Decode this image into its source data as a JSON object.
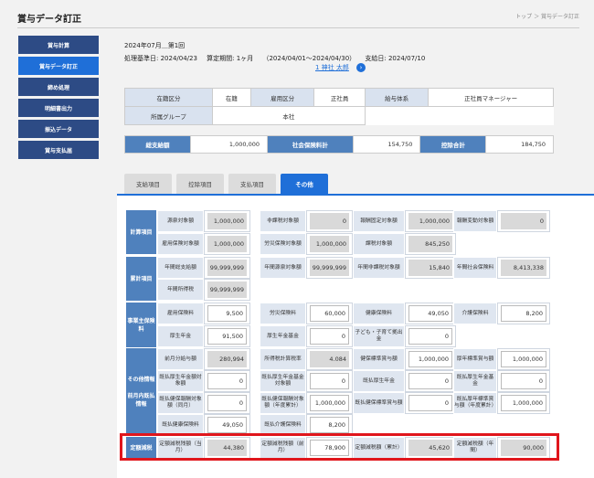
{
  "header": {
    "title": "賞与データ訂正",
    "breadcrumb": "トップ ＞ 賞与データ訂正"
  },
  "sidebar": {
    "items": [
      {
        "label": "賞与計算",
        "active": false
      },
      {
        "label": "賞与データ訂正",
        "active": true
      },
      {
        "label": "締め処理",
        "active": false
      },
      {
        "label": "明細書出力",
        "active": false
      },
      {
        "label": "振込データ",
        "active": false
      },
      {
        "label": "賞与支払届",
        "active": false
      }
    ]
  },
  "info": {
    "period": "2024年07月＿第1回",
    "base_date": "処理基準日: 2024/04/23",
    "calc_period": "算定期間: 1ヶ月",
    "range": "（2024/04/01〜2024/04/30）",
    "pay_date": "支給日: 2024/07/10",
    "employee": "1 神社 太郎"
  },
  "summary": {
    "row1": [
      "在籍区分",
      "在籍",
      "雇用区分",
      "正社員",
      "給与体系",
      "正社員マネージャー"
    ],
    "group_label": "所属グループ",
    "group_value": "本社",
    "totals": [
      "総支給額",
      "1,000,000",
      "社会保険料計",
      "154,750",
      "控除合計",
      "184,750"
    ]
  },
  "tabs": [
    {
      "label": "支給項目",
      "active": false
    },
    {
      "label": "控除項目",
      "active": false
    },
    {
      "label": "支払項目",
      "active": false
    },
    {
      "label": "その他",
      "active": true
    }
  ],
  "sections": {
    "keisan": "計算項目",
    "ruikei": "累計項目",
    "jigyonushi": "事業主保険料",
    "sonota": "その他情報\n\n前月内既払情報",
    "teigaku": "定額減税"
  },
  "cells": {
    "r1": [
      [
        "源泉対象額",
        "1,000,000"
      ],
      [
        "非課税対象額",
        "0"
      ],
      [
        "報酬固定対象額",
        "1,000,000"
      ],
      [
        "報酬変動対象額",
        "0"
      ]
    ],
    "r2": [
      [
        "雇用保険対象額",
        "1,000,000"
      ],
      [
        "労災保険対象額",
        "1,000,000"
      ],
      [
        "課税対象額",
        "845,250"
      ]
    ],
    "r3": [
      [
        "年間総支給額",
        "99,999,999"
      ],
      [
        "年間源泉対象額",
        "99,999,999"
      ],
      [
        "年間非課税対象額",
        "15,840"
      ],
      [
        "年間社会保険料",
        "8,413,338"
      ]
    ],
    "r4": [
      [
        "年間所得税",
        "99,999,999"
      ]
    ],
    "r5": [
      [
        "雇用保険料",
        "9,500"
      ],
      [
        "労災保険料",
        "60,000"
      ],
      [
        "健康保険料",
        "49,050"
      ],
      [
        "介護保険料",
        "8,200"
      ]
    ],
    "r6": [
      [
        "厚生年金",
        "91,500"
      ],
      [
        "厚生年金基金",
        "0"
      ],
      [
        "子ども・子育て拠出金",
        "0"
      ]
    ],
    "r7": [
      [
        "前月分給与額",
        "280,994"
      ],
      [
        "所得税計算税率",
        "4.084"
      ],
      [
        "健保標準賞与額",
        "1,000,000"
      ],
      [
        "厚年標準賞与額",
        "1,000,000"
      ]
    ],
    "r8": [
      [
        "既払厚生年金額対象額",
        "0"
      ],
      [
        "既払厚生年金基金対象額",
        "0"
      ],
      [
        "既払厚生年金",
        "0"
      ],
      [
        "既払厚生年金基金",
        "0"
      ]
    ],
    "r9": [
      [
        "既払健保報酬対象額（同月）",
        "0"
      ],
      [
        "既払健保報酬対象額（年度累計）",
        "1,000,000"
      ],
      [
        "既払健保標準賞与額",
        "0"
      ],
      [
        "既払厚年標準賞与額（年度累計）",
        "1,000,000"
      ]
    ],
    "r10": [
      [
        "既払健康保険料",
        "49,050"
      ],
      [
        "既払介護保険料",
        "8,200"
      ]
    ],
    "r11": [
      [
        "定額減税残額（当月）",
        "44,380"
      ],
      [
        "定額減税残額（前月）",
        "78,900"
      ],
      [
        "定額減税額（累計）",
        "45,620"
      ],
      [
        "定額減税額（年間）",
        "90,000"
      ]
    ]
  }
}
